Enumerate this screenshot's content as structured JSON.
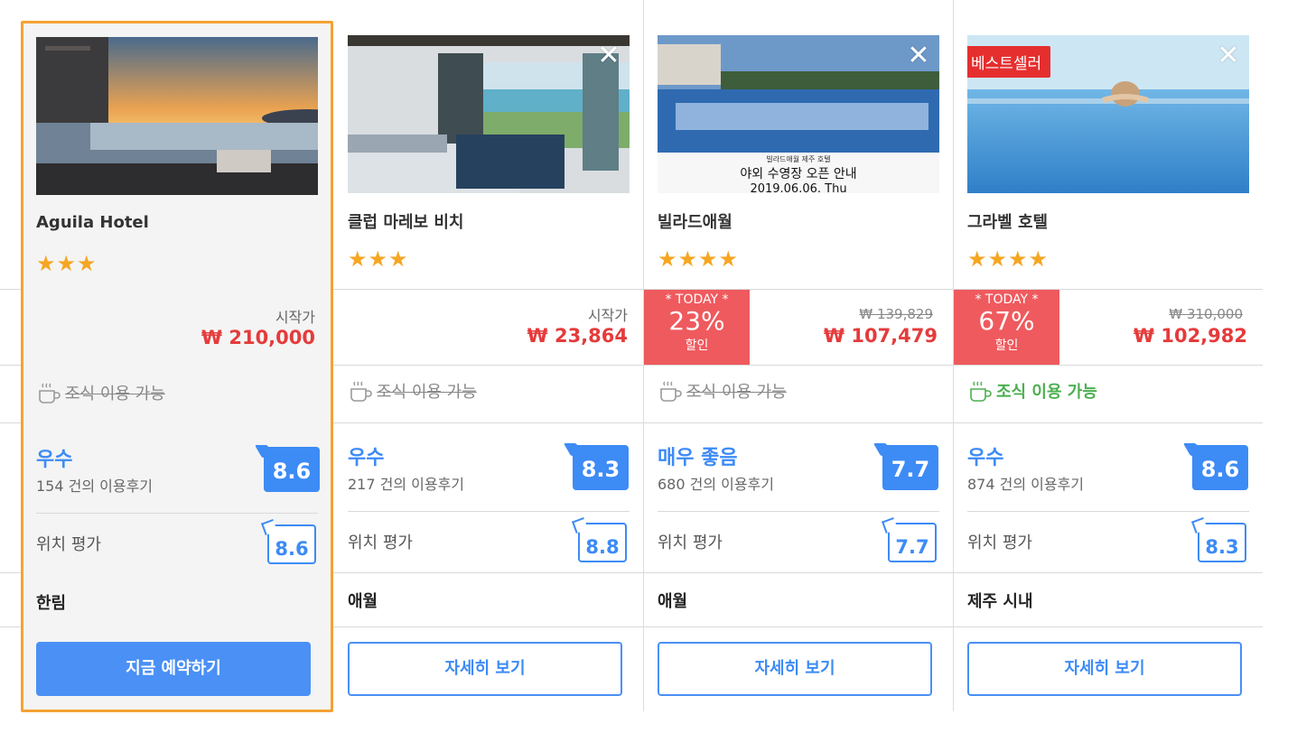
{
  "hotels": [
    {
      "name": "Aguila Hotel",
      "stars": "★★★",
      "start_label": "시작가",
      "price": "₩ 210,000",
      "breakfast": "조식 이용 가능",
      "rating_word": "우수",
      "reviews": "154 건의 이용후기",
      "score": "8.6",
      "location_label": "위치 평가",
      "location_score": "8.6",
      "area": "한림",
      "button": "지금 예약하기"
    },
    {
      "name": "클럽 마레보 비치",
      "stars": "★★★",
      "start_label": "시작가",
      "price": "₩ 23,864",
      "breakfast": "조식 이용 가능",
      "rating_word": "우수",
      "reviews": "217 건의 이용후기",
      "score": "8.3",
      "location_label": "위치 평가",
      "location_score": "8.8",
      "area": "애월",
      "button": "자세히 보기",
      "close": "✕"
    },
    {
      "name": "빌라드애월",
      "stars": "★★★★",
      "today_label": "* TODAY *",
      "discount": "23%",
      "discount_label": "할인",
      "original_price": "₩ 139,829",
      "price": "₩ 107,479",
      "breakfast": "조식 이용 가능",
      "rating_word": "매우 좋음",
      "reviews": "680 건의 이용후기",
      "score": "7.7",
      "location_label": "위치 평가",
      "location_score": "7.7",
      "area": "애월",
      "button": "자세히 보기",
      "close": "✕",
      "photo_sign_line1": "빌라드애월 제주 호텔",
      "photo_sign_line2": "야외 수영장 오픈 안내",
      "photo_sign_line3": "2019.06.06. Thu"
    },
    {
      "name": "그라벨 호텔",
      "stars": "★★★★",
      "best_badge": "베스트셀러",
      "today_label": "* TODAY *",
      "discount": "67%",
      "discount_label": "할인",
      "original_price": "₩ 310,000",
      "price": "₩ 102,982",
      "breakfast": "조식 이용 가능",
      "rating_word": "우수",
      "reviews": "874 건의 이용후기",
      "score": "8.6",
      "location_label": "위치 평가",
      "location_score": "8.3",
      "area": "제주 시내",
      "button": "자세히 보기",
      "close": "✕"
    }
  ],
  "colors": {
    "highlight_border": "#f5a233",
    "price_red": "#e53b3b",
    "today_bg": "#ef5a5e",
    "rating_blue": "#3d8bf5",
    "breakfast_green": "#4caf50"
  }
}
